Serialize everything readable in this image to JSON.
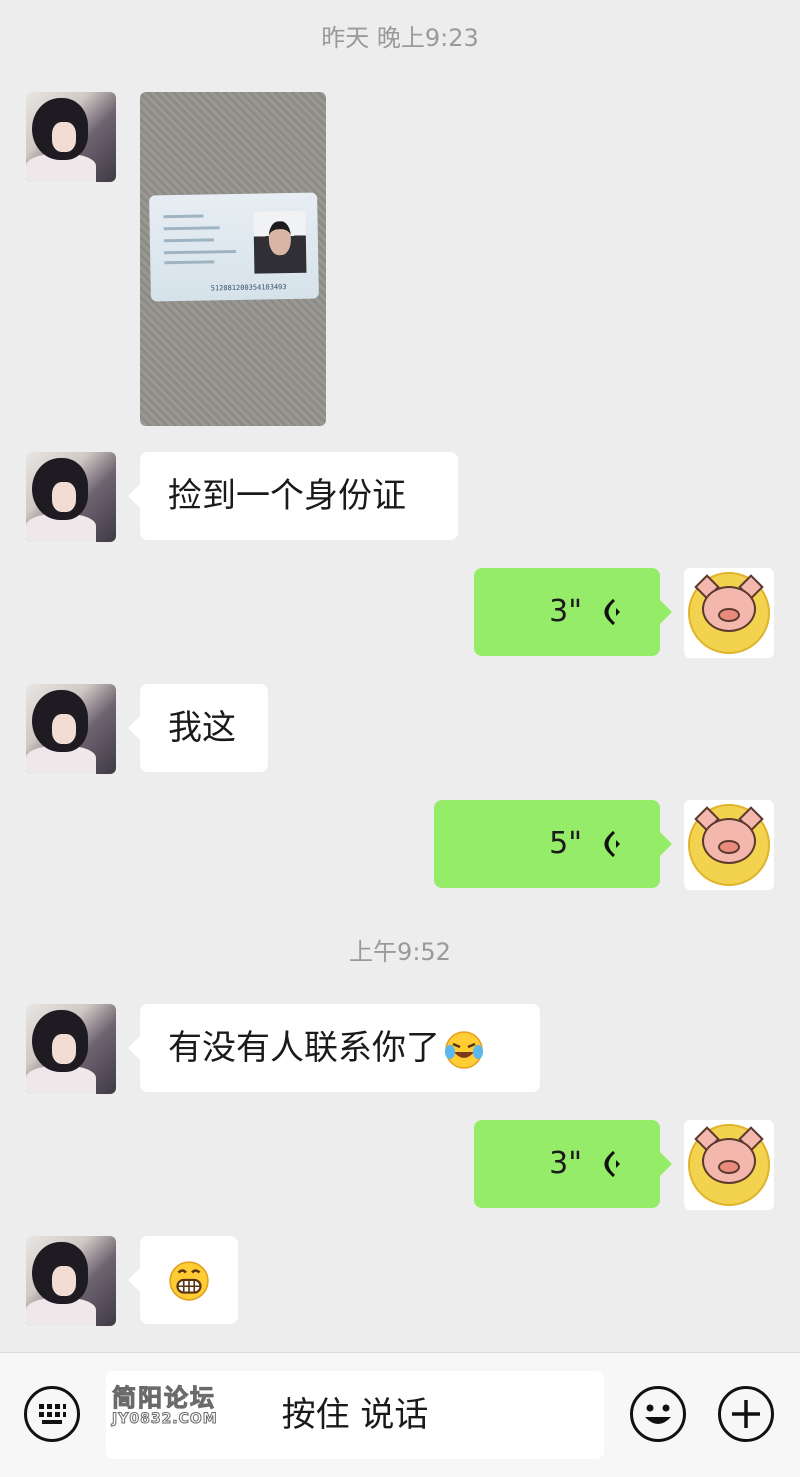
{
  "timestamps": [
    "昨天 晚上9:23",
    "上午9:52"
  ],
  "messages": {
    "text1": "捡到一个身份证",
    "voice1": "3\"",
    "text2": "我这",
    "voice2": "5\"",
    "text3": "有没有人联系你了",
    "voice3": "3\""
  },
  "id_card": {
    "number": "512081200354103493"
  },
  "input_bar": {
    "talk_label": "按住 说话"
  },
  "watermark": {
    "line1": "简阳论坛",
    "line2": "JY0832.COM"
  },
  "colors": {
    "outgoing": "#95ec69",
    "incoming": "#ffffff",
    "background": "#ededed"
  },
  "icons": [
    "keyboard-icon",
    "voice-wave-icon",
    "emoji-icon",
    "plus-icon"
  ]
}
